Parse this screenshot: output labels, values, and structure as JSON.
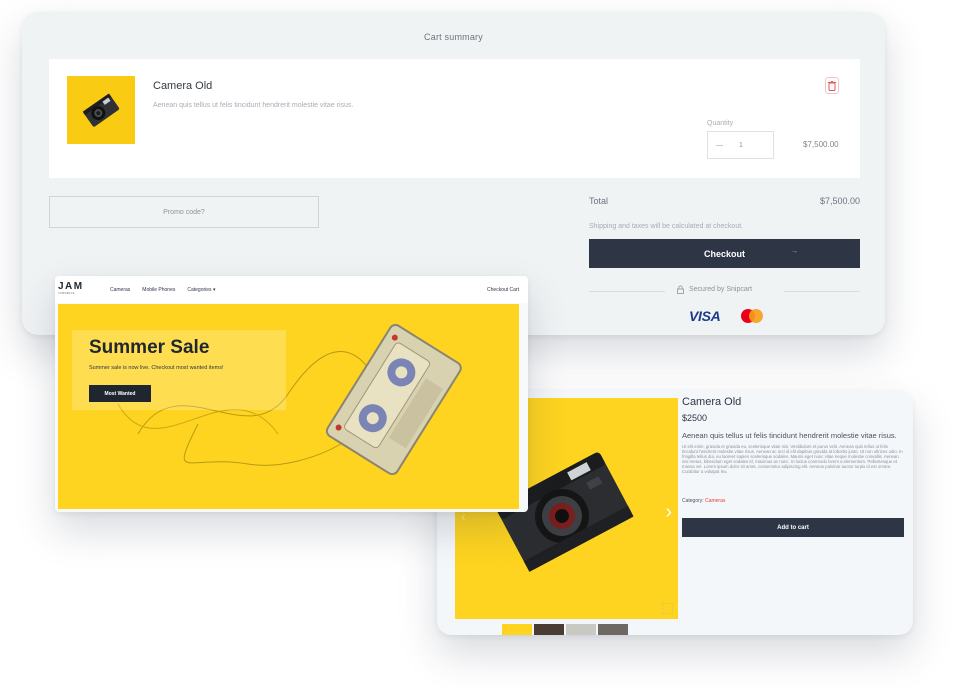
{
  "cart": {
    "title": "Cart summary",
    "item": {
      "name": "Camera Old",
      "description": "Aenean quis tellus ut felis tincidunt hendrerit molestie vitae risus.",
      "quantity_label": "Quantity",
      "quantity": "1",
      "decrement": "—",
      "line_total": "$7,500.00"
    },
    "promo_label": "Promo code?",
    "total_label": "Total",
    "total_value": "$7,500.00",
    "shipping_note": "Shipping and taxes will be calculated at checkout.",
    "checkout_label": "Checkout",
    "checkout_arrow": "→",
    "secured_label": "Secured by Snipcart",
    "card_brand_visa": "VISA",
    "icons": {
      "trash": "trash-icon",
      "lock": "lock-icon",
      "mastercard": "mastercard-logo"
    }
  },
  "store": {
    "logo": "JAM",
    "logo_sub": "COMMERCE",
    "nav": {
      "items": [
        "Cameras",
        "Mobile Phones",
        "Categories ▾"
      ],
      "cart_link": "Checkout Cart"
    },
    "banner": {
      "title": "Summer Sale",
      "subtitle": "Summer sale is now live. Checkout most wanted items!",
      "cta": "Most Wanted"
    }
  },
  "product": {
    "title": "Camera Old",
    "price": "$2500",
    "lead": "Aenean quis tellus ut felis tincidunt hendrerit molestie vitae risus.",
    "body": "Ut elit enim, gravida et gravida eu, scelerisque vitae nisi. Vestibulum et purus velit. Aenean quis tellus ut felis tincidunt hendrerit molestie vitae risus. Aenean ac orci id elit dapibus gravida at lobortis justo. Ut non ultrices odio. In fringilla tellus dui, eu laoreet sapien scelerisque sodales. Mauris eget nunc vitae neque molestie convallis. Aenean nisi metus, bibendum eget sodales id, maximus ac nunc. In luctus commodo lorem a elementum. Pellentesque et massa vel. Lorem ipsum dolor sit amet, consectetur adipiscing elit. Aenean pulvinar auctor turpis id est ornare. Curabitur a volutpat leo.",
    "category_label": "Category:",
    "category_value": "Cameras",
    "add_to_cart": "Add to cart",
    "gallery_next": "›",
    "gallery_prev": "‹",
    "thumb_colors": [
      "#fed420",
      "#4a3b33",
      "#c9c9c4",
      "#6e6862"
    ]
  },
  "colors": {
    "accent_yellow": "#fed420",
    "dark_button": "#2e3646",
    "category_link": "#e23b3b"
  }
}
